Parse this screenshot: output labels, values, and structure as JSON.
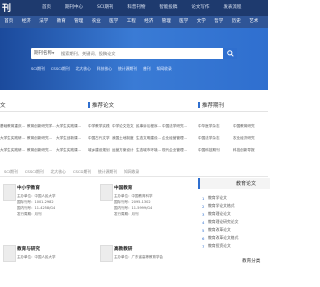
{
  "brand": {
    "logo_text": "刊",
    "accent": "#2f6fcf",
    "header_bg": "#1e3a6e"
  },
  "top_nav": [
    "首页",
    "期刊中心",
    "SCI期刊",
    "科普刊物",
    "智能投稿",
    "论文写作",
    "发表流程"
  ],
  "category_nav": [
    "首页",
    "经济",
    "法学",
    "教育",
    "管理",
    "农业",
    "医学",
    "工程",
    "经济",
    "管理",
    "医学",
    "文学",
    "哲学",
    "历史",
    "艺术",
    "法学"
  ],
  "search": {
    "type_label": "期刊名称",
    "placeholder": "搜索期刊、关键词、投稿论文"
  },
  "hot_links": [
    "SCI期刊",
    "CSSCI期刊",
    "北大核心",
    "科技核心",
    "统计源期刊",
    "普刊",
    "知网收录"
  ],
  "sections": {
    "left_title": "文",
    "middle_title": "推荐论文",
    "right_title": "推荐期刊"
  },
  "left_grid": [
    [
      "基础教育重庆...",
      "教育创新研究学...",
      "大学生实践课..."
    ],
    [
      "大学生实践研...",
      "教育创新研究...",
      "大学生创新课..."
    ],
    [
      "大学生实践研...",
      "教育创新研究...",
      "大学生实践课..."
    ]
  ],
  "middle_grid": [
    [
      "中学教学实践",
      "中学论文范文",
      "民事诉讼程序...",
      "中国法学研究..."
    ],
    [
      "中国古代文学",
      "我国土地制度",
      "生态文明建设...",
      "企业经营管理..."
    ],
    [
      "城乡建设规划",
      "运营方案设计",
      "生态城市环境...",
      "现代企业管理..."
    ]
  ],
  "right_grid": [
    [
      "中华医学杂志",
      "中国教育研究"
    ],
    [
      "中国法学杂志",
      "农业经济研究"
    ],
    [
      "中国科技期刊",
      "科技创新导报"
    ]
  ],
  "tabs": [
    "SCI期刊",
    "CSSCI期刊",
    "北大核心",
    "CSCD期刊",
    "统计源期刊",
    "知网收录"
  ],
  "cards": [
    {
      "title": "中小学教育",
      "lines": [
        "主办单位：中国人民大学",
        "国际刊号：1001-2982",
        "国内刊号：11-4258/G4",
        "发行周期：月刊"
      ]
    },
    {
      "title": "中国教育",
      "lines": [
        "主办单位：中国教育科学",
        "国际刊号：2095-1302",
        "国内刊号：11-5999/G4",
        "发行周期：月刊"
      ]
    },
    {
      "title": "教育与研究",
      "lines": [
        "主办单位：中国人民大学"
      ]
    },
    {
      "title": "高教教研",
      "lines": [
        "主办单位：广东省高等教育学会"
      ]
    }
  ],
  "sidebar": {
    "title": "教育论文",
    "items": [
      "教育学论文",
      "教育学论文格式",
      "教育理论论文",
      "教育理论研究论文",
      "教育改革论文",
      "教育改革论文格式",
      "教育投资论文"
    ],
    "footer": "教育分类"
  }
}
